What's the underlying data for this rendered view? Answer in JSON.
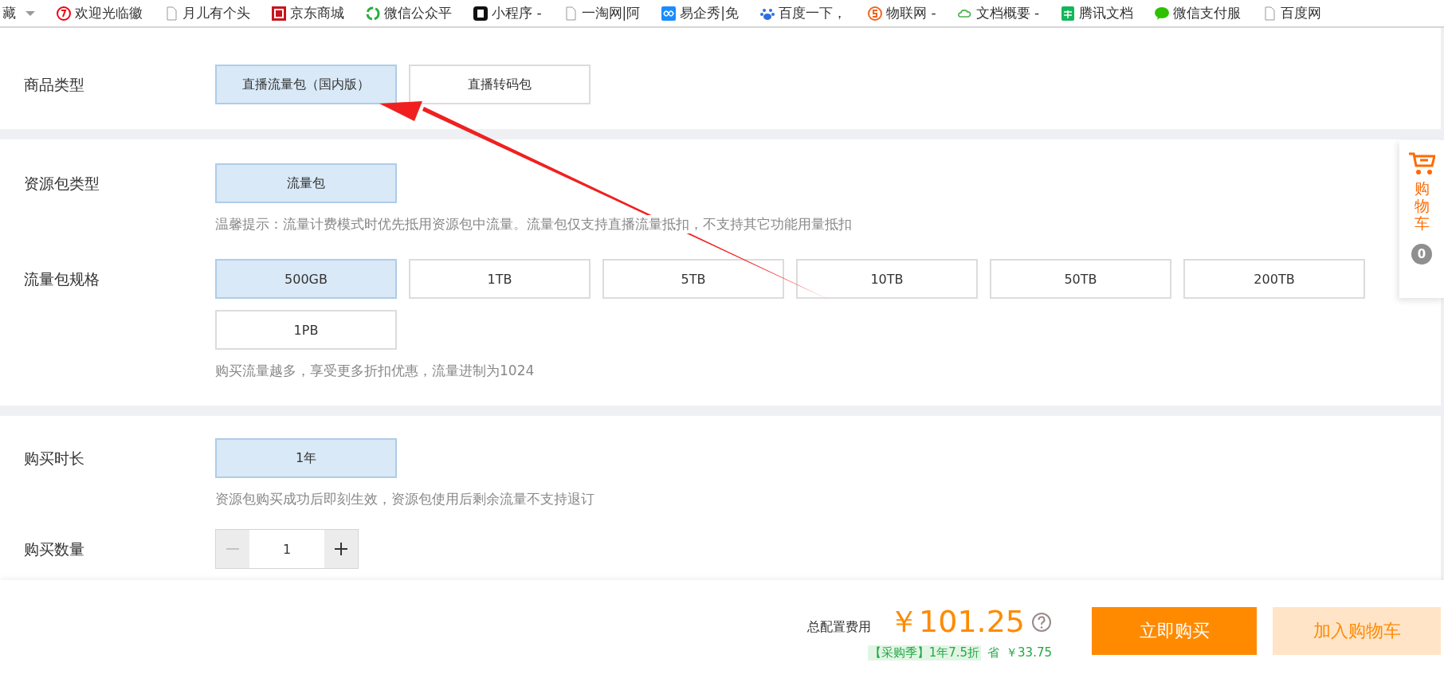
{
  "bookmarks": [
    {
      "label": "藏",
      "kind": "folder"
    },
    {
      "label": "欢迎光临徽",
      "kind": "site"
    },
    {
      "label": "月儿有个头",
      "kind": "page"
    },
    {
      "label": "京东商城",
      "kind": "site"
    },
    {
      "label": "微信公众平",
      "kind": "site"
    },
    {
      "label": "小程序 -",
      "kind": "site"
    },
    {
      "label": "一淘网|阿",
      "kind": "page"
    },
    {
      "label": "易企秀|免",
      "kind": "site"
    },
    {
      "label": "百度一下，",
      "kind": "site"
    },
    {
      "label": "物联网 -",
      "kind": "site"
    },
    {
      "label": "文档概要 -",
      "kind": "site"
    },
    {
      "label": "腾讯文档",
      "kind": "site"
    },
    {
      "label": "微信支付服",
      "kind": "site"
    },
    {
      "label": "百度网",
      "kind": "page"
    }
  ],
  "sections": [
    {
      "rows": [
        {
          "label": "商品类型",
          "kind": "options",
          "options": [
            {
              "label": "直播流量包（国内版）",
              "selected": true
            },
            {
              "label": "直播转码包",
              "selected": false
            }
          ]
        }
      ]
    },
    {
      "rows": [
        {
          "label": "资源包类型",
          "kind": "options",
          "options": [
            {
              "label": "流量包",
              "selected": true
            }
          ],
          "hint": "温馨提示：流量计费模式时优先抵用资源包中流量。流量包仅支持直播流量抵扣，不支持其它功能用量抵扣"
        },
        {
          "label": "流量包规格",
          "kind": "options",
          "options": [
            {
              "label": "500GB",
              "selected": true
            },
            {
              "label": "1TB",
              "selected": false
            },
            {
              "label": "5TB",
              "selected": false
            },
            {
              "label": "10TB",
              "selected": false
            },
            {
              "label": "50TB",
              "selected": false
            },
            {
              "label": "200TB",
              "selected": false
            },
            {
              "label": "1PB",
              "selected": false
            }
          ],
          "hint": "购买流量越多，享受更多折扣优惠，流量进制为1024"
        }
      ]
    },
    {
      "rows": [
        {
          "label": "购买时长",
          "kind": "options",
          "options": [
            {
              "label": "1年",
              "selected": true
            }
          ],
          "hint": "资源包购买成功后即刻生效，资源包使用后剩余流量不支持退订"
        },
        {
          "label": "购买数量",
          "kind": "stepper",
          "value": "1",
          "decrement_disabled": true
        }
      ]
    }
  ],
  "cart": {
    "label": "购物车",
    "count": "0"
  },
  "footer": {
    "total_label": "总配置费用",
    "price": "￥101.25",
    "promo_tag": "【采购季】1年7.5折",
    "save_label": "省",
    "saved": "￥33.75",
    "buttons": [
      {
        "label": "立即购买",
        "kind": "primary"
      },
      {
        "label": "加入购物车",
        "kind": "secondary"
      }
    ]
  }
}
